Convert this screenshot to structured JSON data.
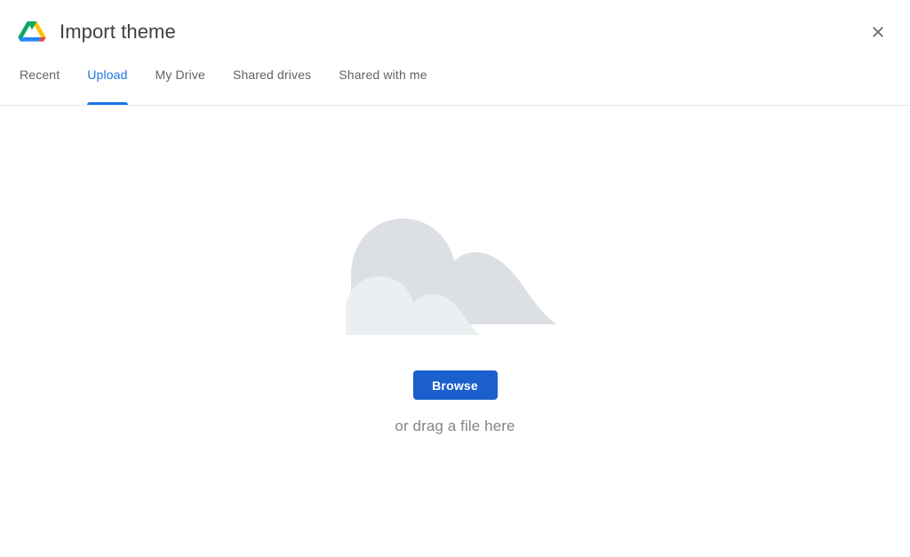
{
  "header": {
    "title": "Import theme",
    "logo_icon": "google-drive-logo",
    "logo_colors": {
      "green": "#0da75f",
      "yellow": "#ffc107",
      "blue": "#2684fc",
      "red": "#ea4335"
    },
    "close_icon": "close-icon",
    "close_label": "Close"
  },
  "tabs": {
    "active_index": 1,
    "accent_color": "#1a73e8",
    "items": [
      {
        "label": "Recent",
        "active": false
      },
      {
        "label": "Upload",
        "active": true
      },
      {
        "label": "My Drive",
        "active": false
      },
      {
        "label": "Shared drives",
        "active": false
      },
      {
        "label": "Shared with me",
        "active": false
      }
    ]
  },
  "upload": {
    "illustration_icon": "cloud-upload-illustration",
    "illustration_colors": {
      "back_cloud": "#dcdfe3",
      "front_cloud": "#eceff1"
    },
    "browse_label": "Browse",
    "browse_color": "#1a5fcb",
    "drag_hint": "or drag a file here"
  }
}
